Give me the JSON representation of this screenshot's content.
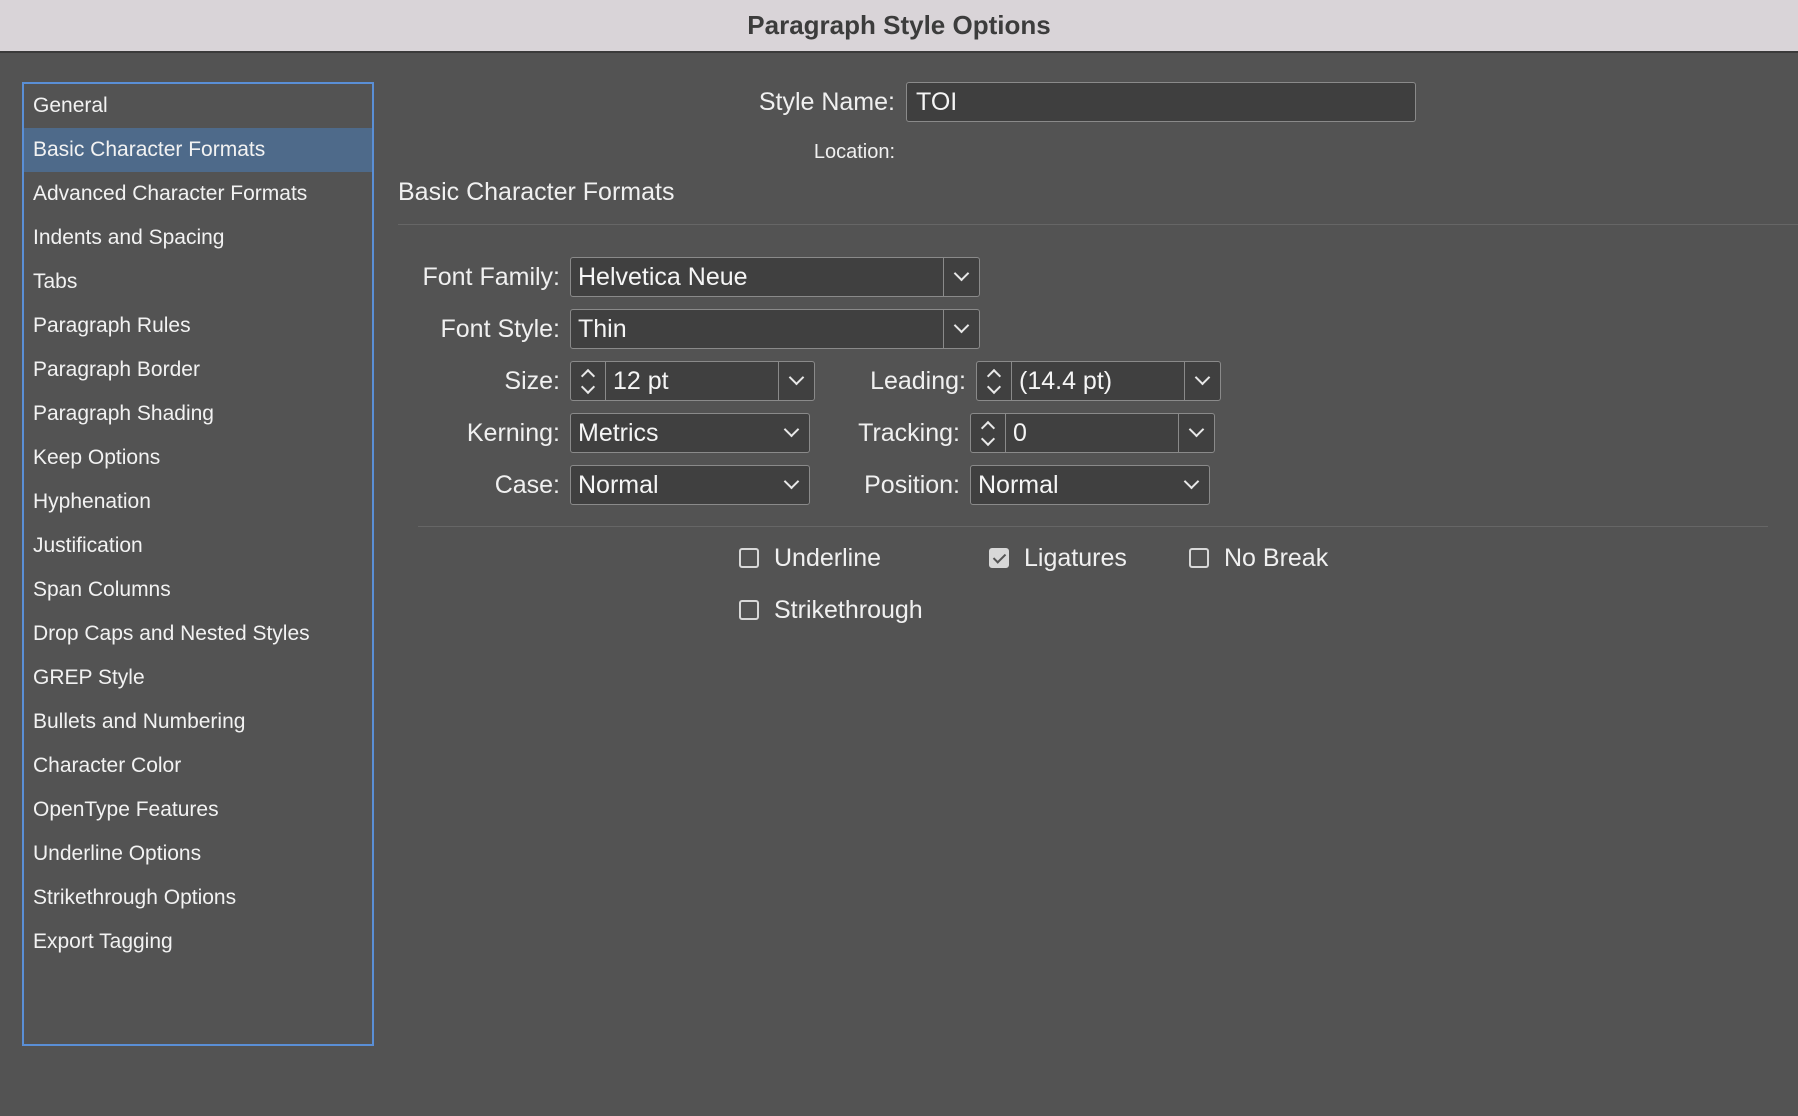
{
  "window": {
    "title": "Paragraph Style Options"
  },
  "sidebar": {
    "items": [
      {
        "label": "General"
      },
      {
        "label": "Basic Character Formats",
        "selected": true
      },
      {
        "label": "Advanced Character Formats"
      },
      {
        "label": "Indents and Spacing"
      },
      {
        "label": "Tabs"
      },
      {
        "label": "Paragraph Rules"
      },
      {
        "label": "Paragraph Border"
      },
      {
        "label": "Paragraph Shading"
      },
      {
        "label": "Keep Options"
      },
      {
        "label": "Hyphenation"
      },
      {
        "label": "Justification"
      },
      {
        "label": "Span Columns"
      },
      {
        "label": "Drop Caps and Nested Styles"
      },
      {
        "label": "GREP Style"
      },
      {
        "label": "Bullets and Numbering"
      },
      {
        "label": "Character Color"
      },
      {
        "label": "OpenType Features"
      },
      {
        "label": "Underline Options"
      },
      {
        "label": "Strikethrough Options"
      },
      {
        "label": "Export Tagging"
      }
    ]
  },
  "header": {
    "style_name_label": "Style Name:",
    "style_name_value": "TOI",
    "location_label": "Location:"
  },
  "section": {
    "title": "Basic Character Formats",
    "font_family": {
      "label": "Font Family:",
      "value": "Helvetica Neue"
    },
    "font_style": {
      "label": "Font Style:",
      "value": "Thin"
    },
    "size": {
      "label": "Size:",
      "value": "12 pt"
    },
    "leading": {
      "label": "Leading:",
      "value": "(14.4 pt)"
    },
    "kerning": {
      "label": "Kerning:",
      "value": "Metrics"
    },
    "tracking": {
      "label": "Tracking:",
      "value": "0"
    },
    "case": {
      "label": "Case:",
      "value": "Normal"
    },
    "position": {
      "label": "Position:",
      "value": "Normal"
    }
  },
  "checkboxes": {
    "underline": {
      "label": "Underline",
      "checked": false
    },
    "ligatures": {
      "label": "Ligatures",
      "checked": true
    },
    "no_break": {
      "label": "No Break",
      "checked": false
    },
    "strikethrough": {
      "label": "Strikethrough",
      "checked": false
    }
  },
  "colors": {
    "background": "#535353",
    "titlebar": "#d9d4d8",
    "selection": "#4e6a8a",
    "focus_border": "#5a8fd6"
  }
}
